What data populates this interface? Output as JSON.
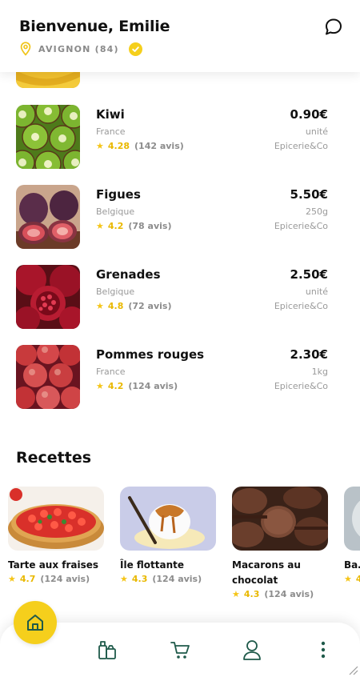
{
  "header": {
    "title": "Bienvenue, Emilie",
    "location": "AVIGNON (84)",
    "location_icon": "map-pin-icon",
    "verified_icon": "check-circle-icon",
    "chat_icon": "chat-bubble-icon"
  },
  "products": [
    {
      "name": "Kiwi",
      "origin": "France",
      "rating": "4.28",
      "reviews": "(142 avis)",
      "price": "0.90€",
      "unit": "unité",
      "shop": "Epicerie&Co"
    },
    {
      "name": "Figues",
      "origin": "Belgique",
      "rating": "4.2",
      "reviews": "(78 avis)",
      "price": "5.50€",
      "unit": "250g",
      "shop": "Epicerie&Co"
    },
    {
      "name": "Grenades",
      "origin": "Belgique",
      "rating": "4.8",
      "reviews": "(72 avis)",
      "price": "2.50€",
      "unit": "unité",
      "shop": "Epicerie&Co"
    },
    {
      "name": "Pommes rouges",
      "origin": "France",
      "rating": "4.2",
      "reviews": "(124 avis)",
      "price": "2.30€",
      "unit": "1kg",
      "shop": "Epicerie&Co"
    }
  ],
  "recipes_section": {
    "title": "Recettes",
    "items": [
      {
        "title": "Tarte aux fraises",
        "rating": "4.7",
        "reviews": "(124 avis)"
      },
      {
        "title": "Île flottante",
        "rating": "4.3",
        "reviews": "(124 avis)"
      },
      {
        "title": "Macarons au chocolat",
        "rating": "4.3",
        "reviews": "(124 avis)"
      },
      {
        "title": "Ba…",
        "rating": "4",
        "reviews": ""
      }
    ]
  },
  "nav": {
    "home_icon": "home-icon",
    "items": [
      "shop-icon",
      "cart-icon",
      "profile-icon",
      "more-vertical-icon"
    ]
  },
  "colors": {
    "accent": "#f5cf1c",
    "star": "#f5c518",
    "nav_icon": "#1f5a4a",
    "muted": "#9a9a9a"
  }
}
